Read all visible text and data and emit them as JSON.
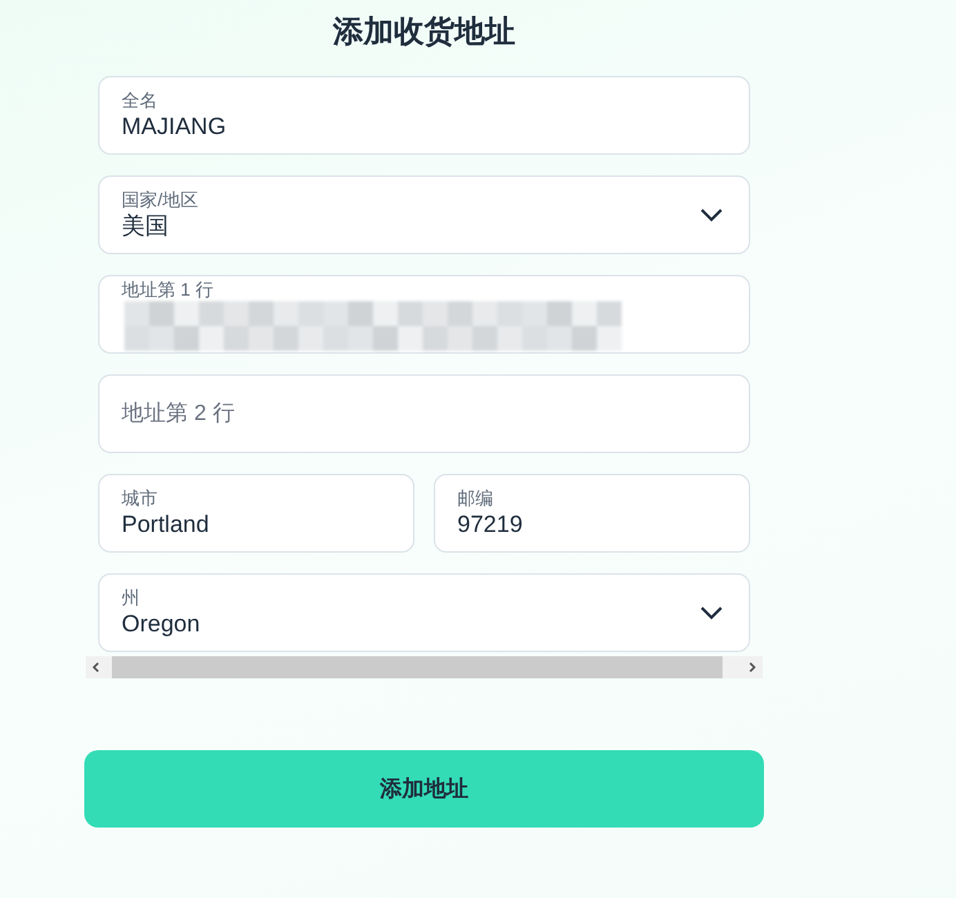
{
  "title": "添加收货地址",
  "rows": [
    {
      "fields": [
        {
          "kind": "text",
          "label": "全名",
          "value": "MAJIANG"
        }
      ]
    },
    {
      "fields": [
        {
          "kind": "select",
          "label": "国家/地区",
          "value": "美国"
        }
      ]
    },
    {
      "fields": [
        {
          "kind": "redacted",
          "label": "地址第 1 行"
        }
      ]
    },
    {
      "fields": [
        {
          "kind": "empty",
          "placeholder": "地址第 2 行"
        }
      ]
    },
    {
      "fields": [
        {
          "kind": "text",
          "label": "城市",
          "value": "Portland"
        },
        {
          "kind": "text",
          "label": "邮编",
          "value": "97219"
        }
      ]
    },
    {
      "fields": [
        {
          "kind": "select",
          "label": "州",
          "value": "Oregon"
        }
      ]
    }
  ],
  "submit": "添加地址"
}
